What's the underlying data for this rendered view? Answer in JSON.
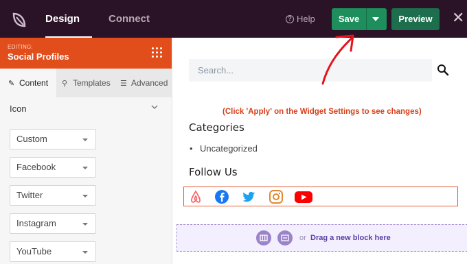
{
  "topbar": {
    "tabs": [
      {
        "label": "Design"
      },
      {
        "label": "Connect"
      }
    ],
    "help_label": "Help",
    "save_label": "Save",
    "preview_label": "Preview"
  },
  "panel": {
    "editing_label": "EDITING:",
    "editing_title": "Social Profiles",
    "subtabs": [
      {
        "label": "Content"
      },
      {
        "label": "Templates"
      },
      {
        "label": "Advanced"
      }
    ],
    "section_title": "Icon",
    "dropdowns": [
      {
        "value": "Custom"
      },
      {
        "value": "Facebook"
      },
      {
        "value": "Twitter"
      },
      {
        "value": "Instagram"
      },
      {
        "value": "YouTube"
      }
    ]
  },
  "content": {
    "search_placeholder": "Search...",
    "notice": "(Click 'Apply' on the Widget Settings to see changes)",
    "categories_heading": "Categories",
    "categories": [
      "Uncategorized"
    ],
    "follow_heading": "Follow Us",
    "drop_or": "or",
    "drop_text": "Drag a new block here"
  },
  "colors": {
    "topbar": "#2a1227",
    "accent_orange": "#e24e1b",
    "save_green": "#1d8e5c",
    "notice_red": "#d8411c",
    "drop_purple": "#9b83cb"
  },
  "icons": [
    "seedprod-logo-icon",
    "help-icon",
    "chevron-down-icon",
    "close-icon",
    "grip-dots-icon",
    "pencil-icon",
    "brush-icon",
    "sliders-icon",
    "search-icon",
    "airbnb-icon",
    "facebook-icon",
    "twitter-icon",
    "instagram-icon",
    "youtube-icon",
    "columns-icon",
    "section-icon"
  ]
}
